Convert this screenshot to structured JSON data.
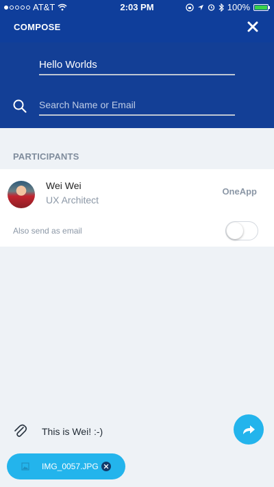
{
  "status": {
    "carrier": "AT&T",
    "time": "2:03 PM",
    "battery": "100%"
  },
  "header": {
    "title": "COMPOSE",
    "close_icon": "close-icon"
  },
  "compose": {
    "subject": "Hello Worlds",
    "search_placeholder": "Search Name or Email"
  },
  "participants": {
    "label": "PARTICIPANTS",
    "items": [
      {
        "name": "Wei Wei",
        "role": "UX Architect",
        "app": "OneApp"
      }
    ],
    "also_send_label": "Also send as email",
    "also_send_enabled": false
  },
  "composer": {
    "message": "This is Wei! :-)",
    "attachment_name": "IMG_0057.JPG"
  },
  "colors": {
    "primary": "#0f3e9b",
    "accent": "#23b4ec",
    "background": "#eef2f6"
  }
}
